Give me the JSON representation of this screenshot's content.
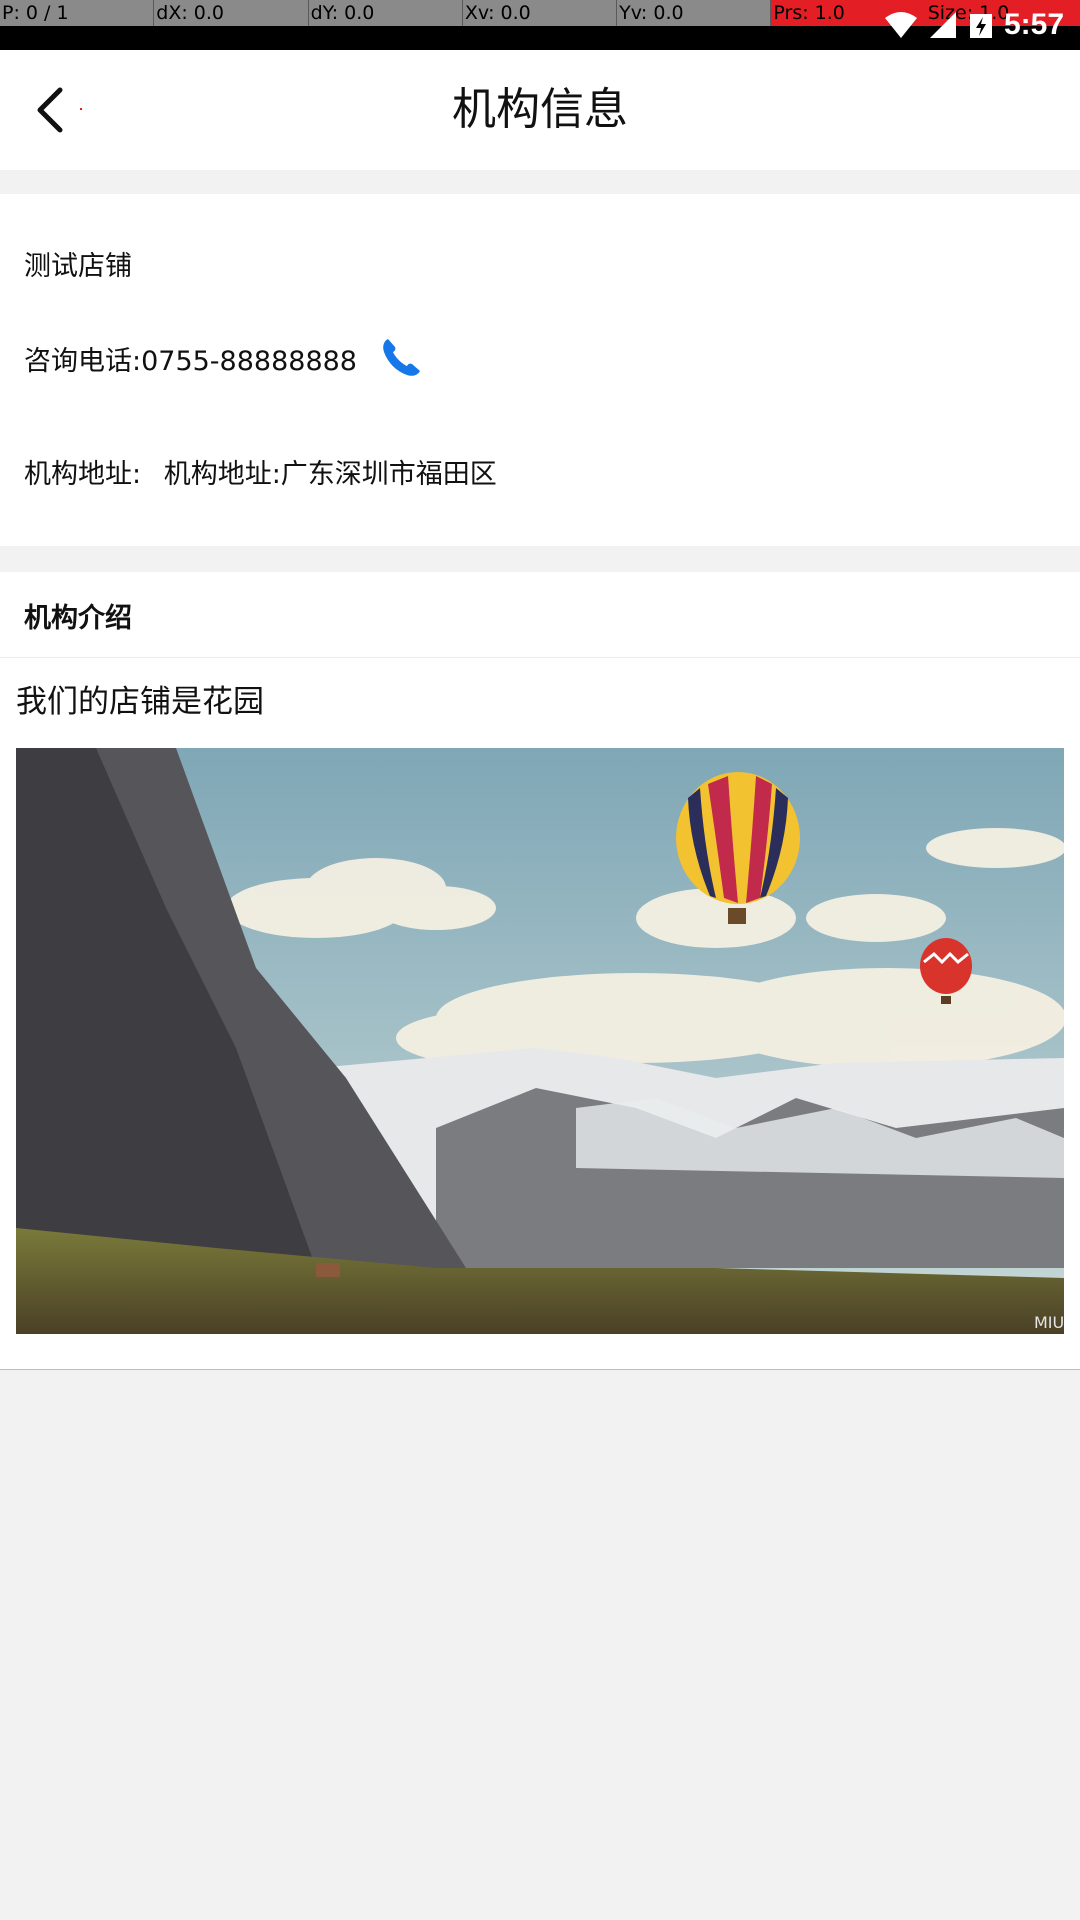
{
  "debug_overlay": {
    "p": "P: 0 / 1",
    "dx": "dX: 0.0",
    "dy": "dY: 0.0",
    "xv": "Xv: 0.0",
    "yv": "Yv: 0.0",
    "prs": "Prs: 1.0",
    "size": "Size: 1.0"
  },
  "status_bar": {
    "time": "5:57",
    "icons": [
      "wifi-icon",
      "signal-icon",
      "battery-charging-icon"
    ]
  },
  "nav": {
    "back_icon": "chevron-left-icon",
    "title": "机构信息"
  },
  "store": {
    "name": "测试店铺",
    "phone_label": "咨询电话:0755-88888888",
    "phone_icon": "phone-icon",
    "address_label": "机构地址:",
    "address_value": "机构地址:广东深圳市福田区"
  },
  "intro": {
    "title": "机构介绍",
    "text": "我们的店铺是花园",
    "image_icon": "landscape-balloons-image",
    "image_watermark": "MIUI"
  },
  "colors": {
    "accent_blue": "#1677e8",
    "alert_red": "#e31e24",
    "background": "#f2f2f2"
  }
}
